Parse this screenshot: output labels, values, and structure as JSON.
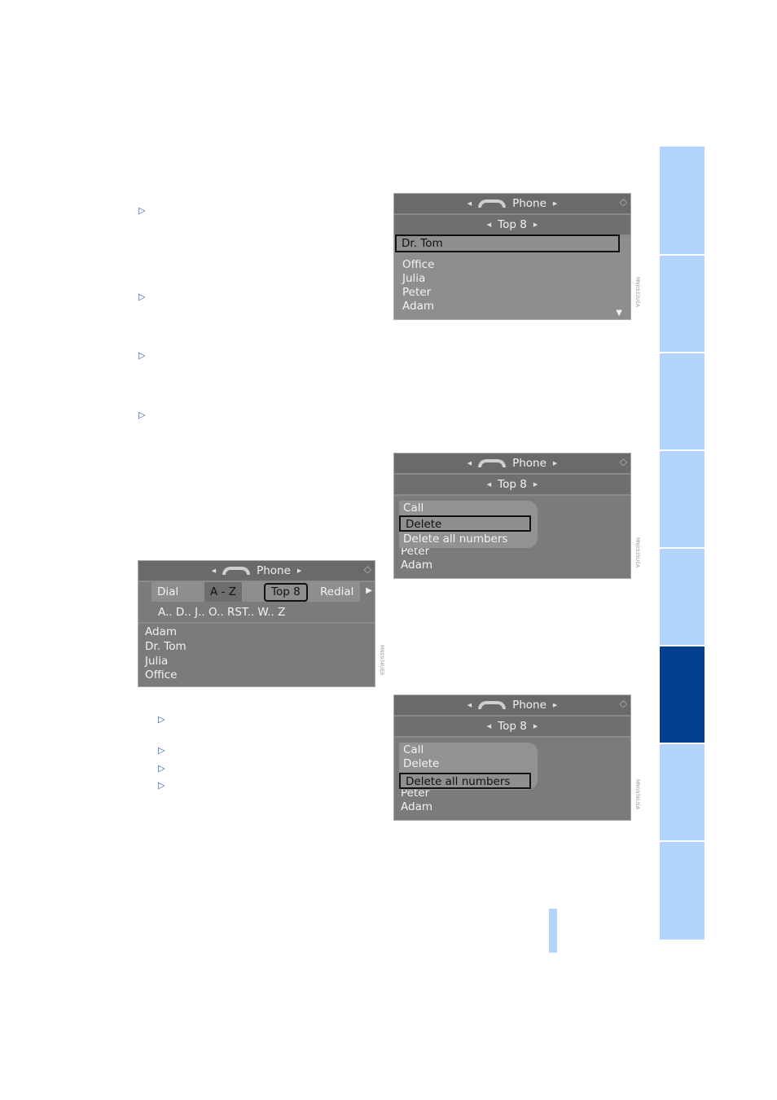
{
  "bullets": [
    "▷",
    "▷",
    "▷",
    "▷",
    "▷",
    "▷",
    "▷",
    "▷"
  ],
  "colors": {
    "tab": "#b3d4fc",
    "tab_active": "#00408f",
    "screen": "#7b7b7b"
  },
  "screen1": {
    "title": "Phone",
    "subtitle": "Top 8",
    "selected": "Dr. Tom",
    "items": [
      "Office",
      "Julia",
      "Peter",
      "Adam"
    ],
    "code": "MN0932UEA"
  },
  "screen2": {
    "title": "Phone",
    "subtitle": "Top 8",
    "items": [
      "Adam"
    ],
    "hidden_item": "Peter",
    "menu": [
      "Call",
      "Delete",
      "Delete all numbers"
    ],
    "selected_index": 1,
    "code": "MN0935UEA"
  },
  "screen3": {
    "title": "Phone",
    "subtitle": "Top 8",
    "items": [
      "Adam"
    ],
    "hidden_item": "Peter",
    "menu": [
      "Call",
      "Delete",
      "Delete all numbers"
    ],
    "selected_index": 2,
    "code": "MN0936UEA"
  },
  "screen4": {
    "title": "Phone",
    "tabs": [
      "Dial",
      "A - Z",
      "Top 8",
      "Redial"
    ],
    "letters": "A.. D.. J.. O.. RST.. W.. Z",
    "items": [
      "Adam",
      "Dr. Tom",
      "Julia",
      "Office"
    ],
    "code": "MN0934UEB"
  }
}
